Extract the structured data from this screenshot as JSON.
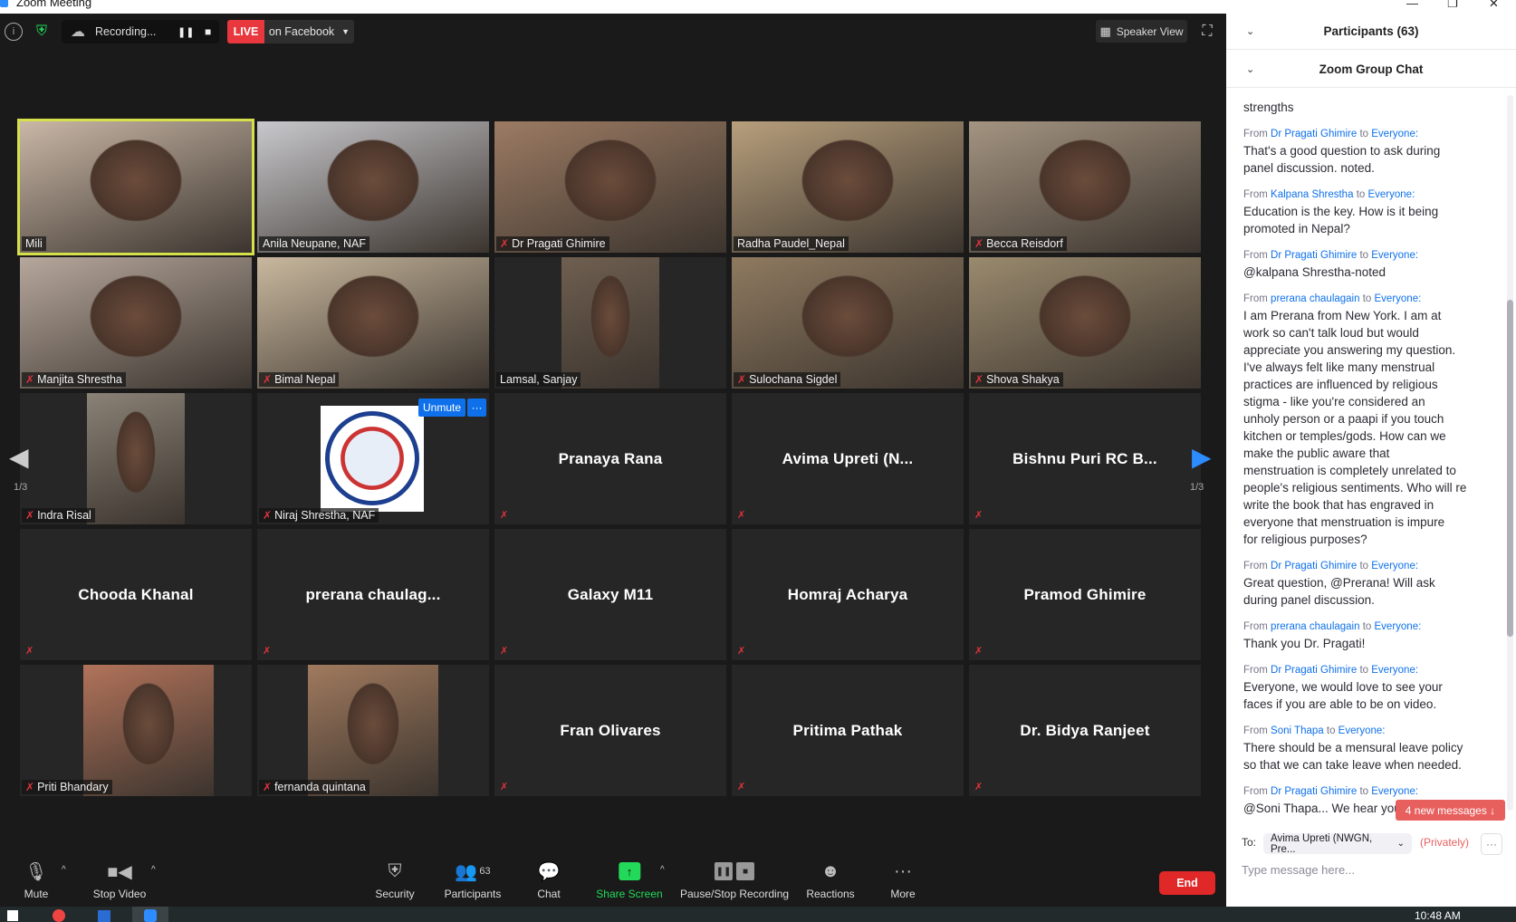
{
  "window": {
    "title": "Zoom Meeting"
  },
  "topbar": {
    "recording_label": "Recording...",
    "live_label": "LIVE",
    "stream_label": "on Facebook",
    "view_label": "Speaker View"
  },
  "pager": {
    "left": "1/3",
    "right": "1/3"
  },
  "tile_actions": {
    "unmute": "Unmute",
    "more": "···"
  },
  "tiles": [
    {
      "name": "Mili",
      "video": true,
      "muted": false,
      "active": true,
      "tone": "#c9b7a6"
    },
    {
      "name": "Anila Neupane, NAF",
      "video": true,
      "muted": false,
      "tone": "#c8c8cc"
    },
    {
      "name": "Dr Pragati Ghimire",
      "video": true,
      "muted": true,
      "tone": "#9c7b63"
    },
    {
      "name": "Radha Paudel_Nepal",
      "video": true,
      "muted": false,
      "tone": "#b79f7c"
    },
    {
      "name": "Becca Reisdorf",
      "video": true,
      "muted": true,
      "tone": "#a49481"
    },
    {
      "name": "Manjita Shrestha",
      "video": true,
      "muted": true,
      "tone": "#b6a79c"
    },
    {
      "name": "Bimal Nepal",
      "video": true,
      "muted": true,
      "tone": "#c9b89e"
    },
    {
      "name": "Lamsal, Sanjay",
      "video": true,
      "muted": false,
      "tone": "#6f5f50",
      "narrow": true
    },
    {
      "name": "Sulochana Sigdel",
      "video": true,
      "muted": true,
      "tone": "#8f7a60"
    },
    {
      "name": "Shova Shakya",
      "video": true,
      "muted": true,
      "tone": "#9a8a6e"
    },
    {
      "name": "Indra Risal",
      "video": true,
      "muted": true,
      "tone": "#8a8276",
      "narrow": true
    },
    {
      "name": "Niraj Shrestha, NAF",
      "logo": true,
      "muted": true
    },
    {
      "name": "Pranaya Rana",
      "muted": true
    },
    {
      "name": "Avima Upreti (N...",
      "muted": true
    },
    {
      "name": "Bishnu Puri RC B...",
      "muted": true
    },
    {
      "name": "Chooda Khanal",
      "muted": true
    },
    {
      "name": "prerana  chaulag...",
      "muted": true
    },
    {
      "name": "Galaxy M11",
      "muted": true
    },
    {
      "name": "Homraj Acharya",
      "muted": true
    },
    {
      "name": "Pramod Ghimire",
      "muted": true
    },
    {
      "name": "Priti Bhandary",
      "video": true,
      "muted": true,
      "tone": "#b2735a",
      "narrow": true
    },
    {
      "name": "fernanda quintana",
      "video": true,
      "muted": true,
      "tone": "#a07a5e",
      "narrow": true
    },
    {
      "name": "Fran Olivares",
      "muted": true
    },
    {
      "name": "Pritima Pathak",
      "muted": true
    },
    {
      "name": "Dr. Bidya Ranjeet",
      "muted": true
    }
  ],
  "toolbar": {
    "mute": "Mute",
    "stop_video": "Stop Video",
    "security": "Security",
    "participants": "Participants",
    "participant_count": "63",
    "chat": "Chat",
    "share_screen": "Share Screen",
    "record": "Pause/Stop Recording",
    "reactions": "Reactions",
    "more": "More",
    "end": "End"
  },
  "panel": {
    "participants_header": "Participants (63)",
    "chat_header": "Zoom Group Chat",
    "first_text": "strengths",
    "from_word": "From",
    "to_word": "to",
    "messages": [
      {
        "from": "Dr Pragati Ghimire",
        "to": "Everyone:",
        "text": "That's a good question to ask during\npanel discussion. noted."
      },
      {
        "from": "Kalpana Shrestha",
        "to": "Everyone:",
        "text": "Education is the key. How is it being\npromoted in Nepal?"
      },
      {
        "from": "Dr Pragati Ghimire",
        "to": "Everyone:",
        "text": "@kalpana Shrestha-noted"
      },
      {
        "from": "prerana chaulagain",
        "to": "Everyone:",
        "text": "I am Prerana from New York. I am at\nwork so can't talk loud but would\nappreciate you answering my question.\nI've always felt like many menstrual\npractices are influenced by religious\nstigma - like you're considered an\nunholy person or a paapi if you touch\nkitchen or temples/gods. How can we\nmake the public aware that\nmenstruation is completely unrelated to\npeople's religious sentiments. Who will re\nwrite the book that has engraved in\neveryone that menstruation is impure\nfor religious purposes?"
      },
      {
        "from": "Dr Pragati Ghimire",
        "to": "Everyone:",
        "text": "Great question, @Prerana! Will ask\nduring panel discussion."
      },
      {
        "from": "prerana chaulagain",
        "to": "Everyone:",
        "text": "Thank you Dr. Pragati!"
      },
      {
        "from": "Dr Pragati Ghimire",
        "to": "Everyone:",
        "text": "Everyone, we would love to see your\nfaces if you are able to be on video."
      },
      {
        "from": "Soni Thapa",
        "to": "Everyone:",
        "text": "There should be a mensural leave policy\nso that we can take leave when needed."
      },
      {
        "from": "Dr Pragati Ghimire",
        "to": "Everyone:",
        "text": "@Soni Thapa... We hear you"
      }
    ],
    "new_messages": "4 new messages ↓",
    "to_label": "To:",
    "recipient": "Avima Upreti (NWGN, Pre...",
    "privately": "(Privately)",
    "input_placeholder": "Type message here..."
  },
  "taskbar": {
    "time": "10:48 AM"
  },
  "colors": {
    "accent": "#0e71eb",
    "live": "#e8383d",
    "end": "#e02828",
    "share": "#23d959",
    "active_speaker": "#d5e04a",
    "muted": "#e0323c"
  }
}
